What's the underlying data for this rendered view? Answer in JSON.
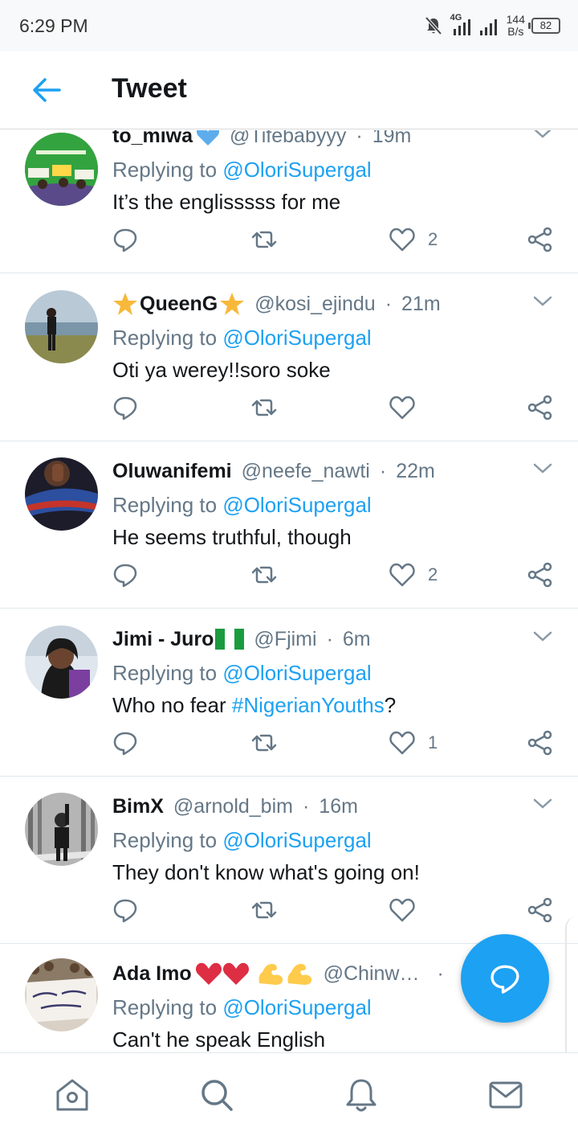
{
  "status_bar": {
    "time": "6:29 PM",
    "network": "4G",
    "speed_value": "144",
    "speed_unit": "B/s",
    "battery": "82"
  },
  "app_bar": {
    "title": "Tweet",
    "back_icon": "arrow-left-icon"
  },
  "colors": {
    "accent": "#1da1f2",
    "muted": "#657786",
    "text": "#14171a",
    "divider": "#e1e8ed"
  },
  "replies": [
    {
      "name": "to_miwa",
      "emoji": "blue-heart",
      "handle": "@Tifebabyyy",
      "sep": "·",
      "time": "19m",
      "replying_prefix": "Replying to ",
      "replying_to": "@OloriSupergal",
      "text": "It’s the englisssss for me",
      "likes": "2"
    },
    {
      "name": "QueenG",
      "name_prefix_emoji": "star",
      "emoji": "star",
      "handle": "@kosi_ejindu",
      "sep": "·",
      "time": "21m",
      "replying_prefix": "Replying to ",
      "replying_to": "@OloriSupergal",
      "text": "Oti ya werey!!soro soke",
      "likes": ""
    },
    {
      "name": "Oluwanifemi",
      "handle": "@neefe_nawti",
      "sep": "·",
      "time": "22m",
      "replying_prefix": "Replying to ",
      "replying_to": "@OloriSupergal",
      "text": "He seems truthful, though",
      "likes": "2"
    },
    {
      "name": "Jimi - Juro",
      "emoji": "nigeria-flag",
      "handle": "@Fjimi",
      "sep": "·",
      "time": "6m",
      "replying_prefix": "Replying to ",
      "replying_to": "@OloriSupergal",
      "text_prefix": "Who no fear ",
      "hashtag": "#NigerianYouths",
      "text_suffix": "?",
      "likes": "1"
    },
    {
      "name": "BimX",
      "handle": "@arnold_bim",
      "sep": "·",
      "time": "16m",
      "replying_prefix": "Replying to ",
      "replying_to": "@OloriSupergal",
      "text": "They don't know what's going on!",
      "likes": ""
    },
    {
      "name": "Ada Imo",
      "emoji": "hearts-and-flexed-biceps",
      "handle": "@Chinw…",
      "sep": "·",
      "time": "",
      "replying_prefix": "Replying to ",
      "replying_to": "@OloriSupergal",
      "text": "Can't he speak English",
      "likes": ""
    }
  ],
  "action_icons": [
    "reply-icon",
    "retweet-icon",
    "like-icon",
    "share-icon"
  ],
  "fab": {
    "icon": "compose-reply-icon"
  },
  "bottom_nav": [
    "home-icon",
    "search-icon",
    "notifications-icon",
    "messages-icon"
  ]
}
